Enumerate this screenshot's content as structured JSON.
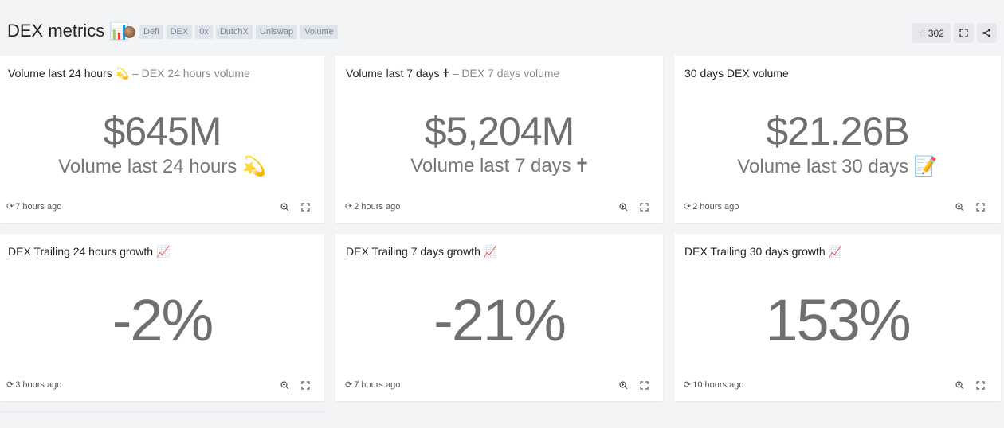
{
  "header": {
    "title": "DEX metrics",
    "title_emoji": "📊",
    "tags": [
      "Defi",
      "DEX",
      "0x",
      "DutchX",
      "Uniswap",
      "Volume"
    ],
    "star_count": "302"
  },
  "cards": [
    {
      "title": "Volume last 24 hours 💫",
      "subtitle": " – DEX 24 hours volume",
      "value": "$645M",
      "caption": "Volume last 24 hours 💫",
      "updated": "7 hours ago"
    },
    {
      "title": "Volume last 7 days 🕇",
      "subtitle": " – DEX 7 days volume",
      "value": "$5,204M",
      "caption": "Volume last 7 days 🕇",
      "updated": "2 hours ago"
    },
    {
      "title": "30 days DEX volume",
      "subtitle": "",
      "value": "$21.26B",
      "caption": "Volume last 30 days 📝",
      "updated": "2 hours ago"
    },
    {
      "title": "DEX Trailing 24 hours growth 📈",
      "subtitle": "",
      "value": "-2%",
      "caption": "",
      "updated": "3 hours ago"
    },
    {
      "title": "DEX Trailing 7 days growth 📈",
      "subtitle": "",
      "value": "-21%",
      "caption": "",
      "updated": "7 hours ago"
    },
    {
      "title": "DEX Trailing 30 days growth 📈",
      "subtitle": "",
      "value": "153%",
      "caption": "",
      "updated": "10 hours ago"
    }
  ]
}
